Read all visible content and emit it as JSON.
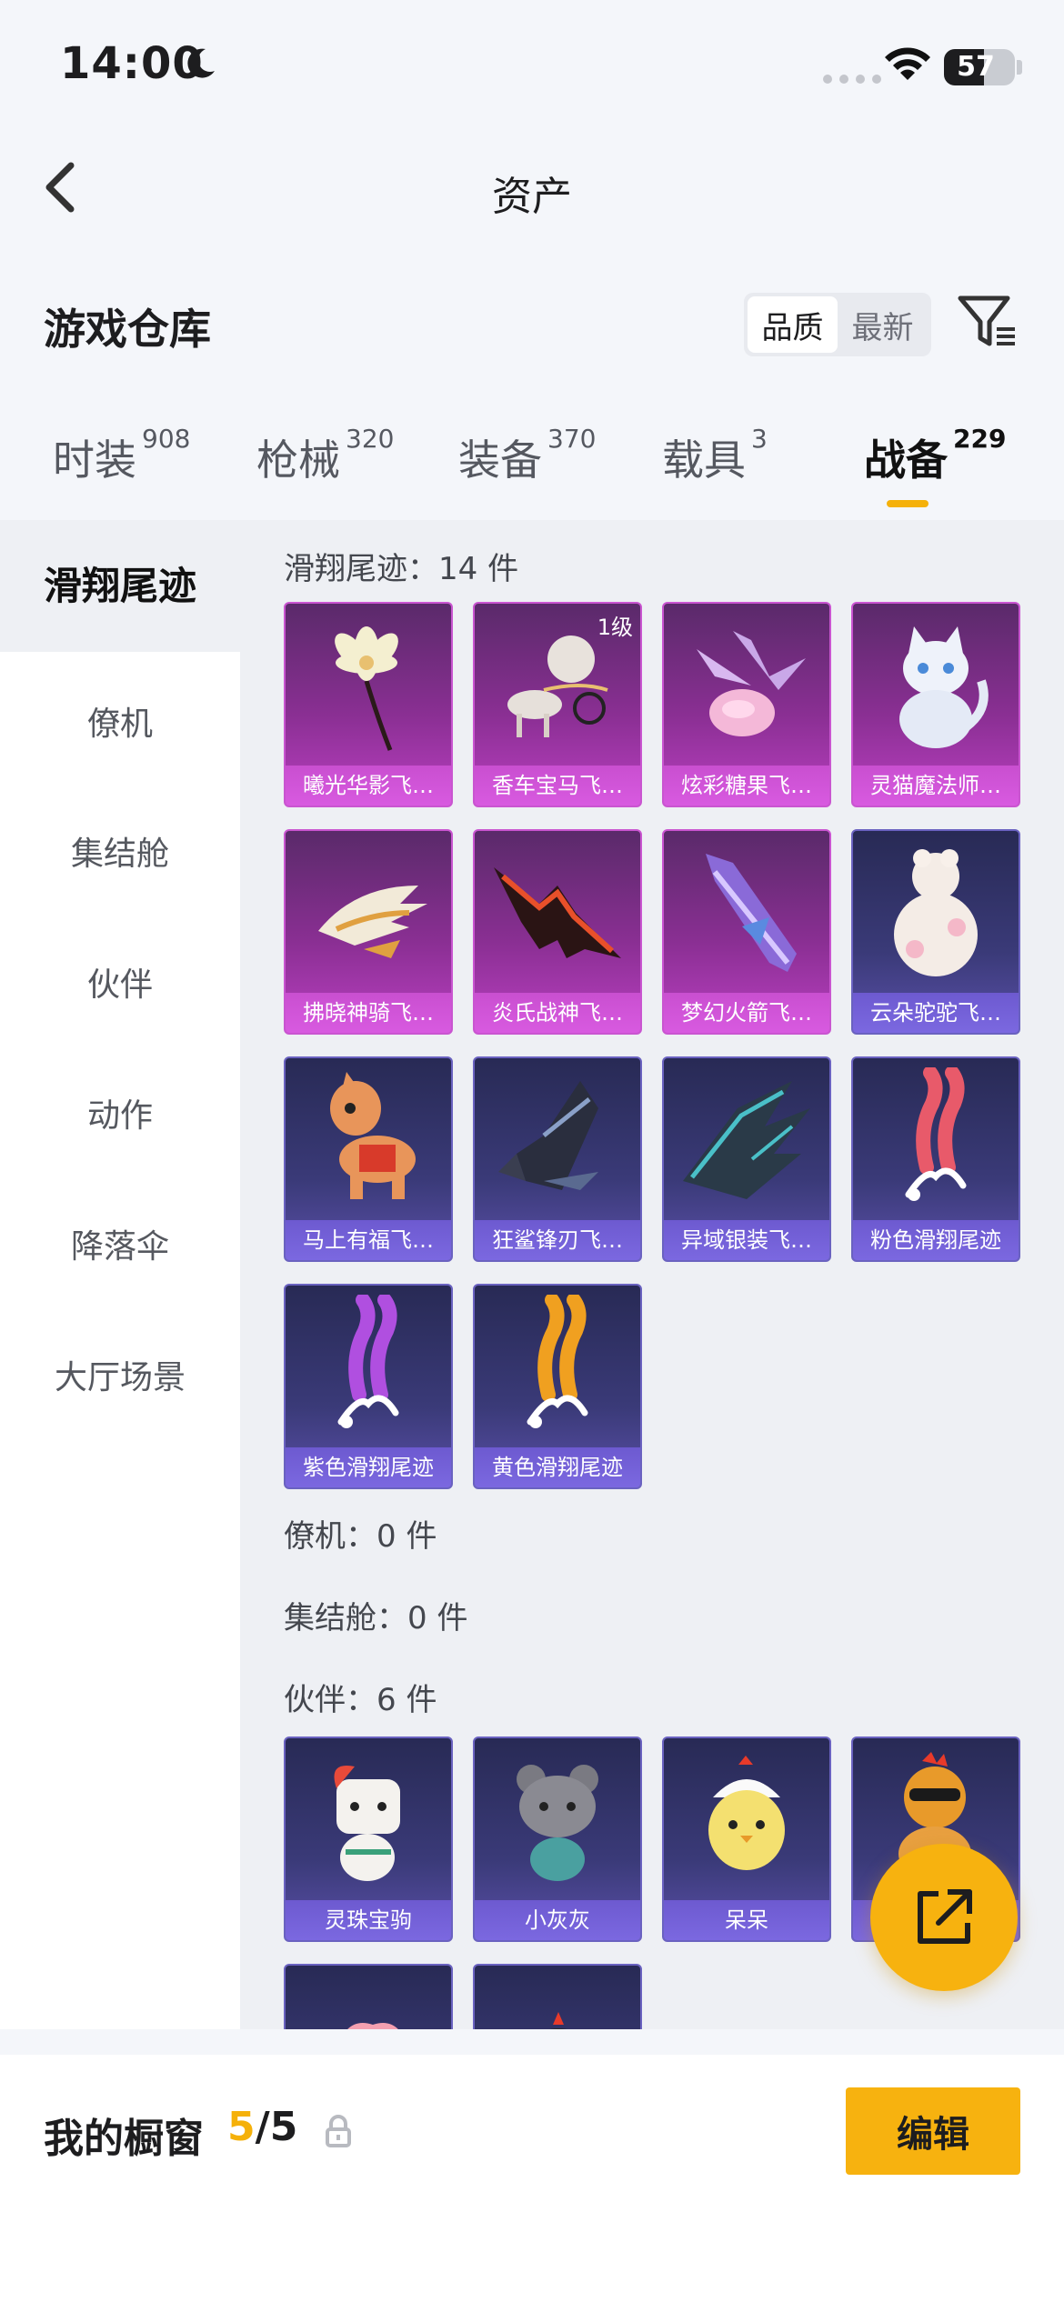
{
  "status_bar": {
    "time": "14:00",
    "battery": "57"
  },
  "nav": {
    "title": "资产"
  },
  "header": {
    "title": "游戏仓库",
    "sort_options": [
      "品质",
      "最新"
    ],
    "sort_active": "品质"
  },
  "tabs": [
    {
      "label": "时装",
      "count": "908"
    },
    {
      "label": "枪械",
      "count": "320"
    },
    {
      "label": "装备",
      "count": "370"
    },
    {
      "label": "载具",
      "count": "3"
    },
    {
      "label": "战备",
      "count": "229"
    }
  ],
  "active_tab": "战备",
  "sidebar": {
    "items": [
      "滑翔尾迹",
      "僚机",
      "集结舱",
      "伙伴",
      "动作",
      "降落伞",
      "大厅场景"
    ]
  },
  "sections": [
    {
      "title": "滑翔尾迹：14 件",
      "items": [
        {
          "name": "曦光华影飞…",
          "rarity": "pink",
          "icon": "flower-icon"
        },
        {
          "name": "香车宝马飞…",
          "rarity": "pink",
          "icon": "carriage-icon",
          "badge": "1级"
        },
        {
          "name": "炫彩糖果飞…",
          "rarity": "pink",
          "icon": "candy-icon"
        },
        {
          "name": "灵猫魔法师…",
          "rarity": "pink",
          "icon": "cat-icon"
        },
        {
          "name": "拂晓神骑飞…",
          "rarity": "pink",
          "icon": "wing-icon"
        },
        {
          "name": "炎氏战神飞…",
          "rarity": "pink",
          "icon": "bat-wing-icon"
        },
        {
          "name": "梦幻火箭飞…",
          "rarity": "pink",
          "icon": "rocket-icon"
        },
        {
          "name": "云朵驼驼飞…",
          "rarity": "blue",
          "icon": "alpaca-icon"
        },
        {
          "name": "马上有福飞…",
          "rarity": "blue",
          "icon": "horse-icon"
        },
        {
          "name": "狂鲨锋刃飞…",
          "rarity": "blue",
          "icon": "shark-icon"
        },
        {
          "name": "异域银装飞…",
          "rarity": "blue",
          "icon": "blade-wing-icon"
        },
        {
          "name": "粉色滑翔尾迹",
          "rarity": "blue",
          "icon": "smoke-trail-icon",
          "color": "#e85a6a"
        },
        {
          "name": "紫色滑翔尾迹",
          "rarity": "blue",
          "icon": "smoke-trail-icon",
          "color": "#b04fe0"
        },
        {
          "name": "黄色滑翔尾迹",
          "rarity": "blue",
          "icon": "smoke-trail-icon",
          "color": "#f0a020"
        }
      ]
    },
    {
      "title": "僚机：0 件",
      "items": []
    },
    {
      "title": "集结舱：0 件",
      "items": []
    },
    {
      "title": "伙伴：6 件",
      "items": [
        {
          "name": "灵珠宝驹",
          "rarity": "blue",
          "icon": "pony-icon"
        },
        {
          "name": "小灰灰",
          "rarity": "blue",
          "icon": "gray-bear-icon"
        },
        {
          "name": "呆呆",
          "rarity": "blue",
          "icon": "chick-icon"
        },
        {
          "name": "",
          "rarity": "blue",
          "icon": "rooster-icon"
        },
        {
          "name": "",
          "rarity": "blue",
          "icon": "pink-pet-icon"
        },
        {
          "name": "",
          "rarity": "blue",
          "icon": "dark-pet-icon"
        }
      ]
    }
  ],
  "showcase": {
    "label": "我的橱窗",
    "current": "5",
    "total": "/5",
    "edit_label": "编辑"
  },
  "colors": {
    "accent": "#f7b20f",
    "rare_pink": "#b93fc0",
    "rare_blue": "#5a4fa8"
  }
}
